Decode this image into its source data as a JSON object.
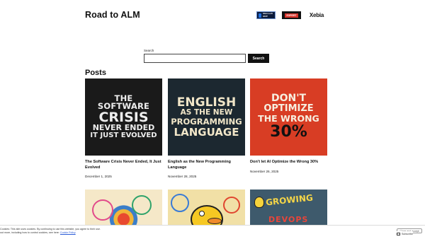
{
  "header": {
    "site_title": "Road to ALM",
    "badges": {
      "mvp_text": "Microsoft MVP",
      "red_text": "EXPERT",
      "xebia_text": "Xebia"
    }
  },
  "search": {
    "label": "Search",
    "placeholder": "",
    "button_label": "Search"
  },
  "posts": {
    "heading": "Posts",
    "items": [
      {
        "title": "The Software Crisis Never Ended, It Just Evolved",
        "date": "December 1, 2025",
        "image_lines": [
          "THE SOFTWARE",
          "CRISIS",
          "NEVER ENDED",
          "IT JUST EVOLVED"
        ]
      },
      {
        "title": "English as the New Programming Language",
        "date": "November 28, 2025",
        "image_lines": [
          "ENGLISH",
          "AS THE NEW",
          "PROGRAMMING",
          "LANGUAGE"
        ]
      },
      {
        "title": "Don't let AI Optimize the Wrong 30%",
        "date": "November 26, 2025",
        "image_lines": [
          "DON'T",
          "OPTIMIZE",
          "THE WRONG",
          "30%"
        ]
      }
    ],
    "row2_image_text": {
      "third_line1": "GROWING",
      "third_line2": "DEVOPS"
    }
  },
  "cookie_bar": {
    "line1": "Cookies: This site uses cookies. By continuing to use this website, you agree to their use.",
    "line2_prefix": "out more, including how to control cookies, see here:",
    "link_text": "Cookie Policy",
    "close_label": "Close and accept"
  },
  "subscribe": {
    "label": "Subscribe"
  },
  "colors": {
    "accent": "#111111",
    "card1_bg": "#1a1a1a",
    "card2_bg": "#1c2830",
    "card3_bg": "#d83d24"
  }
}
